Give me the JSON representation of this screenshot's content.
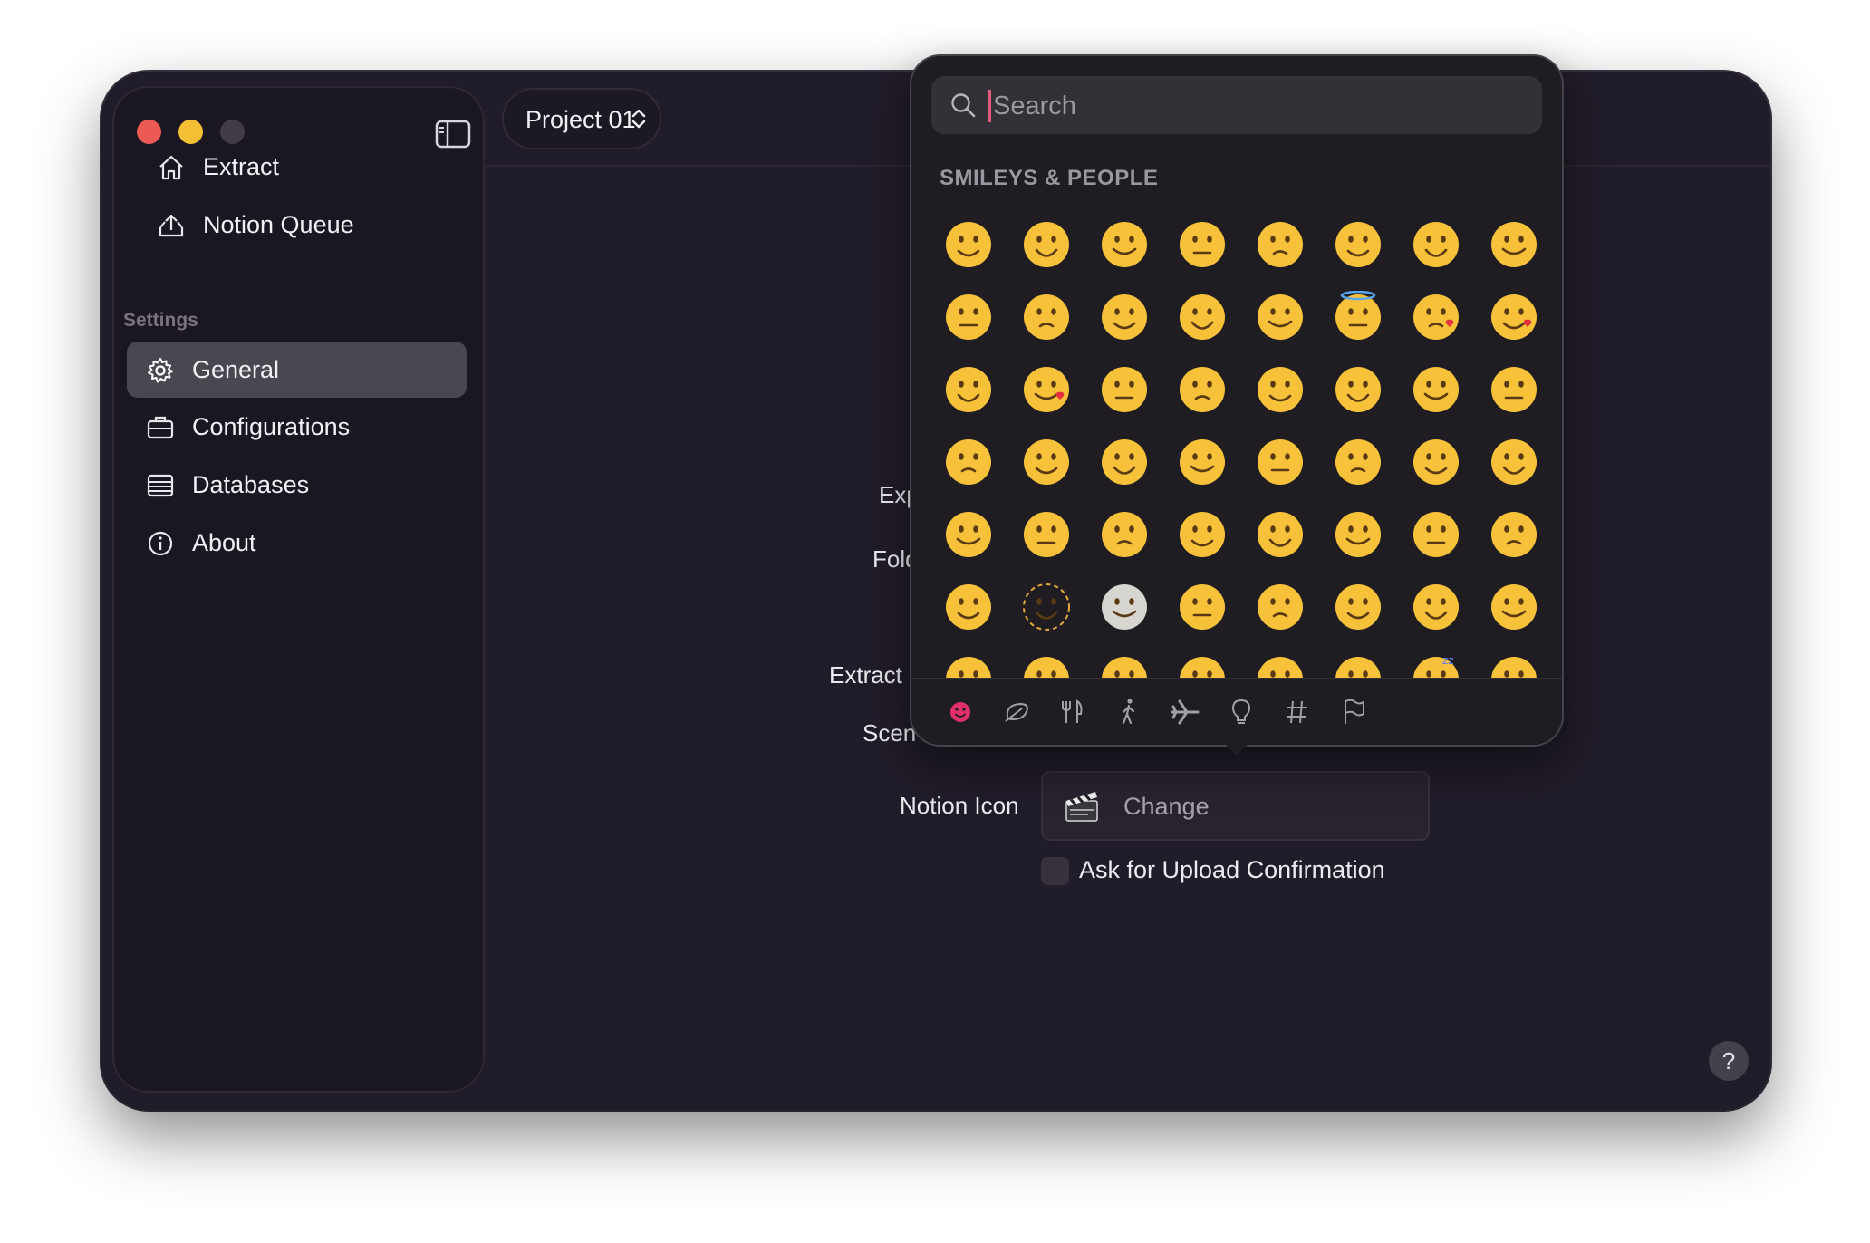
{
  "window": {
    "controls": [
      "close",
      "minimize",
      "zoom"
    ]
  },
  "sidebar": {
    "items": [
      {
        "label": "Extract",
        "icon": "house-icon"
      },
      {
        "label": "Notion Queue",
        "icon": "tray-upload-icon"
      }
    ],
    "settings_section_label": "Settings",
    "settings_items": [
      {
        "label": "General",
        "icon": "gear-icon",
        "selected": true
      },
      {
        "label": "Configurations",
        "icon": "briefcase-icon"
      },
      {
        "label": "Databases",
        "icon": "list-table-icon"
      },
      {
        "label": "About",
        "icon": "info-circle-icon"
      }
    ]
  },
  "toolbar": {
    "project_label": "Project 01",
    "project_chevron_icon": "chevron-up-down-icon"
  },
  "form": {
    "labels_partial": [
      "Exp",
      "Fold",
      "Extract",
      "Scen"
    ],
    "notion_icon_label": "Notion Icon",
    "notion_icon_button": "Change",
    "notion_icon_emoji": "clapper-board-icon",
    "upload_confirmation_label": "Ask for Upload Confirmation",
    "upload_confirmation_checked": false
  },
  "help_button": "?",
  "emoji_picker": {
    "search_placeholder": "Search",
    "category_title": "SMILEYS & PEOPLE",
    "category_tabs": [
      "smileys-icon",
      "nature-icon",
      "food-icon",
      "activity-icon",
      "travel-icon",
      "objects-icon",
      "symbols-icon",
      "flags-icon"
    ],
    "selected_tab": "smileys-icon",
    "accent_color": "#e0306a",
    "emoji_rows": [
      [
        "grinning-face",
        "grinning-big-eyes",
        "grinning-smiling-eyes",
        "beaming-face",
        "squinting-face",
        "grinning-sweat",
        "rolling-laughing",
        "tears-of-joy"
      ],
      [
        "slightly-smiling",
        "upside-down",
        "melting-face",
        "winking-face",
        "smiling-eyes",
        "halo-face",
        "smiling-hearts",
        "heart-eyes"
      ],
      [
        "star-struck",
        "blowing-kiss",
        "kissing-face",
        "relaxed-face",
        "kissing-closed-eyes",
        "kissing-smiling-eyes",
        "holding-back-tears",
        "savoring-food"
      ],
      [
        "face-with-tongue",
        "winking-tongue",
        "zany-face",
        "squinting-tongue",
        "money-mouth",
        "hugging-face",
        "hand-over-mouth",
        "open-eyes-hand-over-mouth"
      ],
      [
        "peeking-eye",
        "shushing-face",
        "thinking-face",
        "saluting-face",
        "zipper-mouth",
        "raised-eyebrow",
        "neutral-face",
        "expressionless"
      ],
      [
        "no-mouth",
        "dotted-line-face",
        "face-in-clouds",
        "smirking-face",
        "unamused-face",
        "rolling-eyes",
        "grimacing-face",
        "exhaling-face"
      ],
      [
        "lying-face",
        "shaking-face",
        "relieved-face",
        "pensive-face",
        "sleepy-face",
        "drooling-face",
        "sleeping-face",
        "medical-mask"
      ]
    ]
  }
}
